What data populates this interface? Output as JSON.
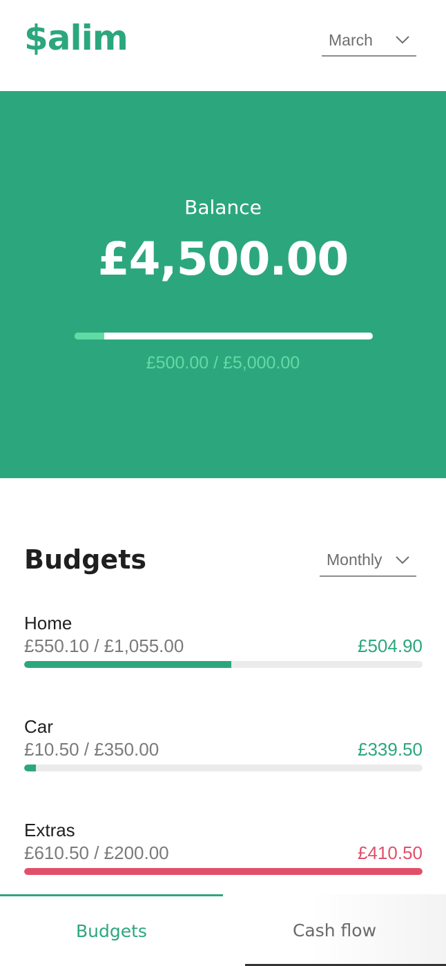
{
  "header": {
    "logo": "$alim",
    "month_select": {
      "value": "March"
    }
  },
  "balance": {
    "label": "Balance",
    "amount": "£4,500.00",
    "progress": 0.1,
    "caption": "£500.00 / £5,000.00"
  },
  "budgets": {
    "title": "Budgets",
    "period_select": {
      "value": "Monthly"
    },
    "items": [
      {
        "name": "Home",
        "spent": "£550.10 / £1,055.00",
        "remaining": "£504.90",
        "progress": 0.52,
        "status": "ok"
      },
      {
        "name": "Car",
        "spent": "£10.50 / £350.00",
        "remaining": "£339.50",
        "progress": 0.03,
        "status": "ok"
      },
      {
        "name": "Extras",
        "spent": "£610.50 / £200.00",
        "remaining": "£410.50",
        "progress": 1.0,
        "status": "over"
      }
    ]
  },
  "tabs": [
    {
      "label": "Budgets",
      "active": true
    },
    {
      "label": "Cash flow",
      "active": false
    }
  ],
  "colors": {
    "accent": "#2ca77d",
    "over_budget": "#e0506a",
    "progress_light": "#5fdba4"
  },
  "icons": {
    "month_select": "chevron-down-icon",
    "period_select": "chevron-down-icon"
  }
}
